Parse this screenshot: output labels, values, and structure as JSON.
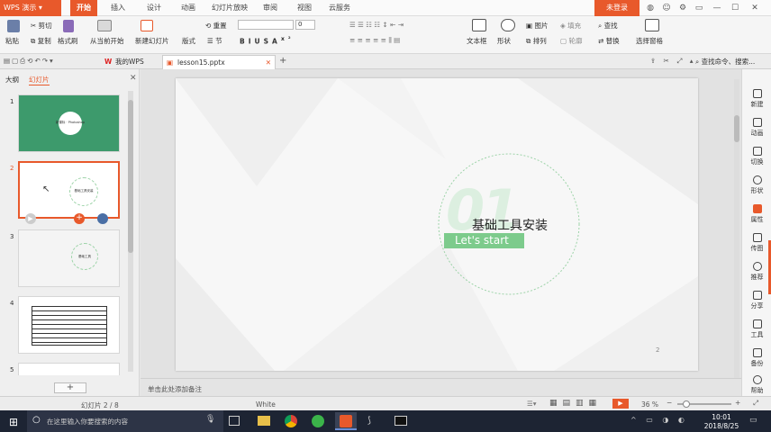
{
  "app": {
    "name": "WPS 演示"
  },
  "menu_tabs": [
    "开始",
    "插入",
    "设计",
    "动画",
    "幻灯片放映",
    "审阅",
    "视图",
    "云服务"
  ],
  "login_label": "未登录",
  "ribbon": {
    "paste": "粘贴",
    "cut": "剪切",
    "copy": "复制",
    "format_painter": "格式刷",
    "from_current": "从当前开始",
    "new_slide": "新建幻灯片",
    "layout": "版式",
    "section": "节",
    "reset": "重置",
    "font_size_value": "0",
    "text_box": "文本框",
    "shape": "形状",
    "picture": "图片",
    "arrange": "排列",
    "fill": "填充",
    "outline": "轮廓",
    "find": "查找",
    "replace": "替换",
    "select_pane": "选择窗格"
  },
  "tabbar": {
    "my_wps": "我的WPS",
    "file_tab": "lesson15.pptx",
    "search": "查找命令、搜索..."
  },
  "left_panel": {
    "outline_tab": "大纲",
    "slides_tab": "幻灯片",
    "numbers": [
      "1",
      "2",
      "3",
      "4",
      "5"
    ],
    "thumb1_title": "新课标 · Photoshop",
    "thumb2_title": "基础工具安装",
    "thumb3_title": "基础工具"
  },
  "slide": {
    "title": "基础工具安装",
    "subtitle": "Let's start",
    "big_number": "01",
    "page_number": "2"
  },
  "notes_placeholder": "单击此处添加备注",
  "right_panel": [
    "新建",
    "动画",
    "切换",
    "形状",
    "属性",
    "传图",
    "推荐",
    "分享",
    "工具",
    "备份",
    "帮助"
  ],
  "status": {
    "slide_count": "幻灯片 2 / 8",
    "theme": "White",
    "zoom": "36 %"
  },
  "taskbar": {
    "search_placeholder": "在这里输入你要搜索的内容",
    "time": "10:01",
    "date": "2018/8/25"
  },
  "colors": {
    "accent": "#e8592b",
    "green": "#3d9a6c",
    "slide_green": "#7dcb8c"
  }
}
